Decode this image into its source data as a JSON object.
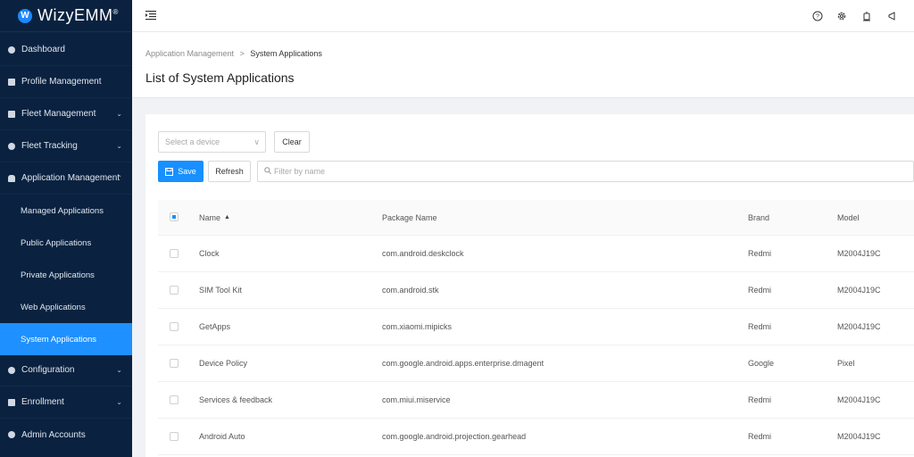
{
  "app": {
    "logo_letter": "W",
    "logo_text": "WizyEMM",
    "logo_mark": "®"
  },
  "sidebar": {
    "items": [
      {
        "label": "Dashboard",
        "icon": "dashboard-icon",
        "has_chevron": false
      },
      {
        "label": "Profile Management",
        "icon": "profile-icon",
        "has_chevron": false
      },
      {
        "label": "Fleet Management",
        "icon": "fleet-icon",
        "has_chevron": true,
        "chevron": "⌄"
      },
      {
        "label": "Fleet Tracking",
        "icon": "location-pin-icon",
        "has_chevron": true,
        "chevron": "⌄"
      },
      {
        "label": "Application Management",
        "icon": "android-icon",
        "has_chevron": true,
        "chevron": "⌃",
        "expanded": true
      },
      {
        "label": "Configuration",
        "icon": "gear-icon",
        "has_chevron": true,
        "chevron": "⌄"
      },
      {
        "label": "Enrollment",
        "icon": "enrollment-icon",
        "has_chevron": true,
        "chevron": "⌄"
      },
      {
        "label": "Admin Accounts",
        "icon": "admin-icon",
        "has_chevron": false
      }
    ],
    "sub_items": [
      {
        "label": "Managed Applications",
        "active": false
      },
      {
        "label": "Public Applications",
        "active": false
      },
      {
        "label": "Private Applications",
        "active": false
      },
      {
        "label": "Web Applications",
        "active": false
      },
      {
        "label": "System Applications",
        "active": true
      }
    ]
  },
  "topbar": {
    "icons": [
      "help-icon",
      "settings-icon",
      "notification-icon",
      "announcement-icon"
    ]
  },
  "breadcrumb": {
    "parent": "Application Management",
    "separator": ">",
    "current": "System Applications"
  },
  "page_title": "List of System Applications",
  "toolbar": {
    "device_placeholder": "Select a device",
    "clear_label": "Clear",
    "save_label": "Save",
    "refresh_label": "Refresh",
    "filter_placeholder": "Filter by name"
  },
  "table": {
    "columns": [
      "Name",
      "Package Name",
      "Brand",
      "Model"
    ],
    "rows": [
      {
        "name": "Clock",
        "package": "com.android.deskclock",
        "brand": "Redmi",
        "model": "M2004J19C"
      },
      {
        "name": "SIM Tool Kit",
        "package": "com.android.stk",
        "brand": "Redmi",
        "model": "M2004J19C"
      },
      {
        "name": "GetApps",
        "package": "com.xiaomi.mipicks",
        "brand": "Redmi",
        "model": "M2004J19C"
      },
      {
        "name": "Device Policy",
        "package": "com.google.android.apps.enterprise.dmagent",
        "brand": "Google",
        "model": "Pixel"
      },
      {
        "name": "Services & feedback",
        "package": "com.miui.miservice",
        "brand": "Redmi",
        "model": "M2004J19C"
      },
      {
        "name": "Android Auto",
        "package": "com.google.android.projection.gearhead",
        "brand": "Redmi",
        "model": "M2004J19C"
      }
    ]
  },
  "colors": {
    "sidebar_bg": "#0a2240",
    "accent": "#1890ff"
  }
}
